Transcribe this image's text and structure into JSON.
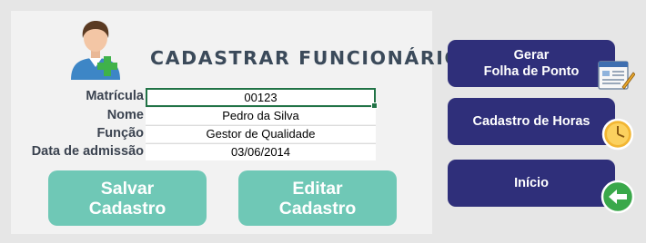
{
  "form": {
    "title": "CADASTRAR FUNCIONÁRIOS",
    "fields": [
      {
        "label": "Matrícula",
        "value": "00123"
      },
      {
        "label": "Nome",
        "value": "Pedro da Silva"
      },
      {
        "label": "Função",
        "value": "Gestor de Qualidade"
      },
      {
        "label": "Data de admissão",
        "value": "03/06/2014"
      }
    ],
    "save_button": {
      "line1": "Salvar",
      "line2": "Cadastro"
    },
    "edit_button": {
      "line1": "Editar",
      "line2": "Cadastro"
    }
  },
  "nav": {
    "timesheet_button": {
      "line1": "Gerar",
      "line2": "Folha de Ponto"
    },
    "hours_button": {
      "label": "Cadastro de Horas"
    },
    "home_button": {
      "label": "Início"
    }
  },
  "colors": {
    "green_button": "#6fc8b6",
    "navy_button": "#2f2f7a",
    "active_cell_border": "#217346"
  },
  "icons": {
    "avatar": "user-add-icon",
    "timesheet": "document-pen-icon",
    "hours": "clock-icon",
    "home": "back-arrow-icon"
  }
}
